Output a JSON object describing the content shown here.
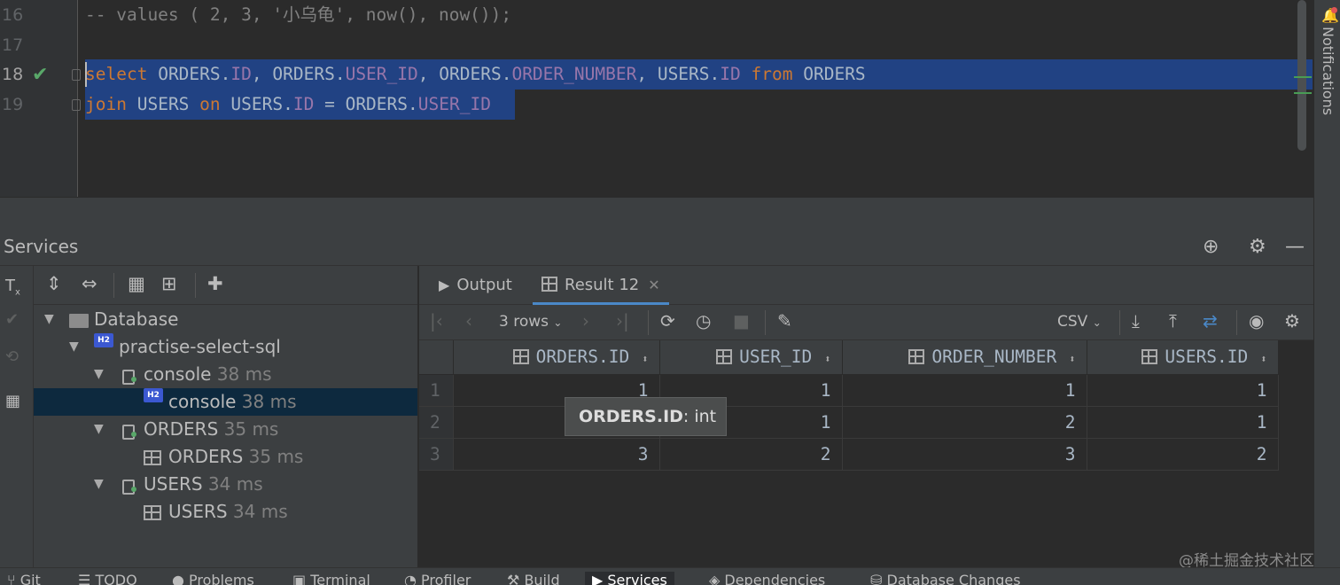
{
  "editor": {
    "lines": [
      {
        "number": "16",
        "text": "-- values ( 2, 3, '小乌龟', now(), now());"
      },
      {
        "number": "17",
        "text": ""
      },
      {
        "number": "18",
        "text": "select ORDERS.ID, ORDERS.USER_ID, ORDERS.ORDER_NUMBER, USERS.ID from ORDERS"
      },
      {
        "number": "19",
        "text": "join USERS on USERS.ID = ORDERS.USER_ID"
      }
    ],
    "tok": {
      "select": "select",
      "orders": "ORDERS",
      "dot": ".",
      "id": "ID",
      "comma": ", ",
      "user_id": "USER_ID",
      "order_number": "ORDER_NUMBER",
      "users": "USERS",
      "from": "from",
      "join": "join",
      "on": "on",
      "eq": " = ",
      "sp": " "
    }
  },
  "notifications": {
    "label": "Notifications"
  },
  "services": {
    "title": "Services",
    "tree": {
      "database": {
        "label": "Database"
      },
      "datasource": {
        "label": "practise-select-sql",
        "badge": "H2"
      },
      "console_group": {
        "label": "console",
        "time": "38 ms"
      },
      "console_item": {
        "label": "console",
        "time": "38 ms",
        "badge": "H2"
      },
      "orders_group": {
        "label": "ORDERS",
        "time": "35 ms"
      },
      "orders_item": {
        "label": "ORDERS",
        "time": "35 ms"
      },
      "users_group": {
        "label": "USERS",
        "time": "34 ms"
      },
      "users_item": {
        "label": "USERS",
        "time": "34 ms"
      }
    }
  },
  "result": {
    "tabs": [
      {
        "label": "Output"
      },
      {
        "label": "Result 12"
      }
    ],
    "rows_label": "3 rows",
    "export_format": "CSV",
    "columns": [
      "ORDERS.ID",
      "USER_ID",
      "ORDER_NUMBER",
      "USERS.ID"
    ],
    "rows": [
      {
        "n": "1",
        "c": [
          "1",
          "1",
          "1",
          "1"
        ]
      },
      {
        "n": "2",
        "c": [
          "2",
          "1",
          "2",
          "1"
        ]
      },
      {
        "n": "3",
        "c": [
          "3",
          "2",
          "3",
          "2"
        ]
      }
    ],
    "tooltip": {
      "name": "ORDERS.ID",
      "type": ": int"
    }
  },
  "bottombar": {
    "items": [
      "Git",
      "TODO",
      "Problems",
      "Terminal",
      "Profiler",
      "Build",
      "Services",
      "Dependencies",
      "Database Changes"
    ]
  },
  "watermark": "@稀土掘金技术社区",
  "colors": {
    "keyword": "#cc7832",
    "field": "#9876aa",
    "selection": "#214283",
    "accent": "#4a88c7"
  }
}
